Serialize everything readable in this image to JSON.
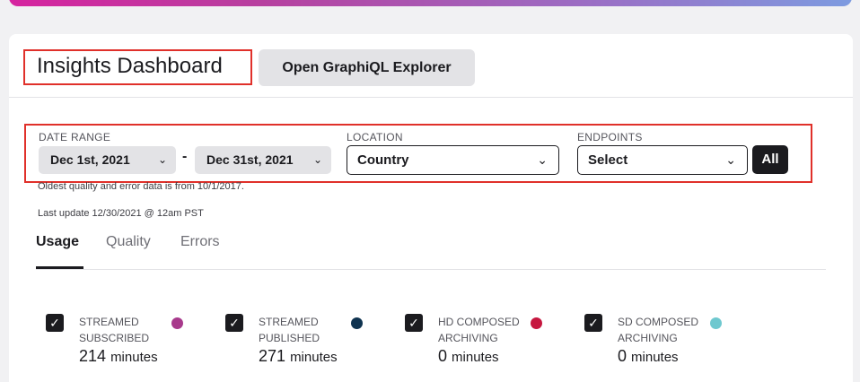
{
  "header": {
    "title": "Insights Dashboard",
    "graphiql_label": "Open GraphiQL Explorer"
  },
  "filters": {
    "date_range_label": "DATE RANGE",
    "date_start": "Dec 1st, 2021",
    "date_separator": "-",
    "date_end": "Dec 31st, 2021",
    "location_label": "LOCATION",
    "location_value": "Country",
    "endpoints_label": "ENDPOINTS",
    "endpoints_value": "Select",
    "all_label": "All"
  },
  "notes": {
    "oldest": "Oldest quality and error data is from 10/1/2017.",
    "last_update": "Last update 12/30/2021 @ 12am PST"
  },
  "tabs": [
    {
      "label": "Usage",
      "active": true
    },
    {
      "label": "Quality",
      "active": false
    },
    {
      "label": "Errors",
      "active": false
    }
  ],
  "metrics": [
    {
      "line1": "STREAMED",
      "line2": "SUBSCRIBED",
      "value": "214",
      "unit": "minutes",
      "color": "#a83a8c",
      "checked": true
    },
    {
      "line1": "STREAMED",
      "line2": "PUBLISHED",
      "value": "271",
      "unit": "minutes",
      "color": "#0f3350",
      "checked": true
    },
    {
      "line1": "HD COMPOSED",
      "line2": "ARCHIVING",
      "value": "0",
      "unit": "minutes",
      "color": "#c6173f",
      "checked": true
    },
    {
      "line1": "SD COMPOSED",
      "line2": "ARCHIVING",
      "value": "0",
      "unit": "minutes",
      "color": "#6ec8cf",
      "checked": true
    }
  ],
  "icons": {
    "chevron": "chevron-down-icon",
    "check": "checkmark-icon"
  }
}
